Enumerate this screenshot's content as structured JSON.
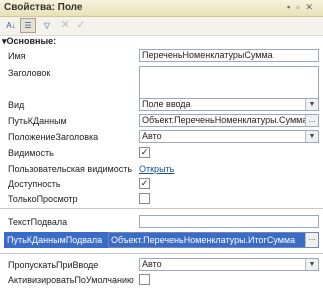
{
  "window": {
    "title": "Свойства: Поле"
  },
  "toolbar": {
    "buttons": [
      "A-Z",
      "Categories",
      "Filter",
      "Close",
      "Check"
    ]
  },
  "group": {
    "label": "Основные:"
  },
  "props": {
    "name": {
      "label": "Имя",
      "value": "ПереченьНоменклатурыСумма"
    },
    "header": {
      "label": "Заголовок",
      "value": ""
    },
    "view": {
      "label": "Вид",
      "value": "Поле ввода"
    },
    "datapath": {
      "label": "ПутьКДанным",
      "value": "Объект.ПереченьНоменклатуры.Сумма"
    },
    "headerpos": {
      "label": "ПоложениеЗаголовка",
      "value": "Авто"
    },
    "visible": {
      "label": "Видимость",
      "checked": true
    },
    "uservis": {
      "label": "Пользовательская видимость",
      "link": "Открыть"
    },
    "enabled": {
      "label": "Доступность",
      "checked": true
    },
    "readonly": {
      "label": "ТолькоПросмотр",
      "checked": false
    },
    "footertext": {
      "label": "ТекстПодвала",
      "value": ""
    },
    "footerpath": {
      "label": "ПутьКДаннымПодвала",
      "value": "Объект.ПереченьНоменклатуры.ИтогСумма"
    },
    "skipinput": {
      "label": "ПропускатьПриВводе",
      "value": "Авто"
    },
    "activate": {
      "label": "АктивизироватьПоУмолчанию",
      "checked": false
    }
  }
}
